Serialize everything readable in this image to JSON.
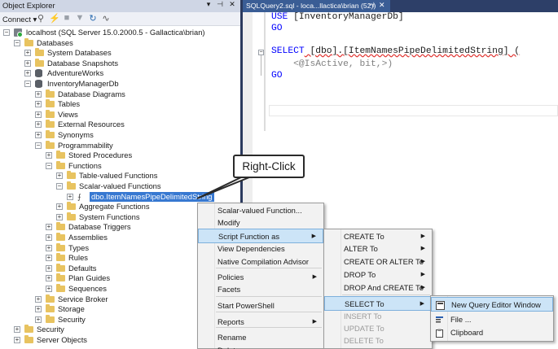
{
  "object_explorer": {
    "title": "Object Explorer",
    "title_controls": [
      "▾",
      "⊣",
      "✕"
    ],
    "toolbar": {
      "connect_label": "Connect ▾",
      "icons": [
        "plug-icon",
        "disconnect-icon",
        "stop-icon",
        "filter-icon",
        "refresh-icon",
        "activity-icon"
      ]
    },
    "tree": [
      {
        "label": "localhost (SQL Server 15.0.2000.5 - Gallactica\\brian)",
        "level": 0,
        "icon": "server",
        "expander": "−"
      },
      {
        "label": "Databases",
        "level": 1,
        "icon": "folder",
        "expander": "−"
      },
      {
        "label": "System Databases",
        "level": 2,
        "icon": "folder",
        "expander": "+"
      },
      {
        "label": "Database Snapshots",
        "level": 2,
        "icon": "folder",
        "expander": "+"
      },
      {
        "label": "AdventureWorks",
        "level": 2,
        "icon": "database",
        "expander": "+"
      },
      {
        "label": "InventoryManagerDb",
        "level": 2,
        "icon": "database",
        "expander": "−"
      },
      {
        "label": "Database Diagrams",
        "level": 3,
        "icon": "folder",
        "expander": "+"
      },
      {
        "label": "Tables",
        "level": 3,
        "icon": "folder",
        "expander": "+"
      },
      {
        "label": "Views",
        "level": 3,
        "icon": "folder",
        "expander": "+"
      },
      {
        "label": "External Resources",
        "level": 3,
        "icon": "folder",
        "expander": "+"
      },
      {
        "label": "Synonyms",
        "level": 3,
        "icon": "folder",
        "expander": "+"
      },
      {
        "label": "Programmability",
        "level": 3,
        "icon": "folder",
        "expander": "−"
      },
      {
        "label": "Stored Procedures",
        "level": 4,
        "icon": "folder",
        "expander": "+"
      },
      {
        "label": "Functions",
        "level": 4,
        "icon": "folder",
        "expander": "−"
      },
      {
        "label": "Table-valued Functions",
        "level": 5,
        "icon": "folder",
        "expander": "+"
      },
      {
        "label": "Scalar-valued Functions",
        "level": 5,
        "icon": "folder",
        "expander": "−"
      },
      {
        "label": "dbo.ItemNamesPipeDelimitedString",
        "level": 6,
        "icon": "function",
        "expander": "+",
        "selected": true
      },
      {
        "label": "Aggregate Functions",
        "level": 5,
        "icon": "folder",
        "expander": "+"
      },
      {
        "label": "System Functions",
        "level": 5,
        "icon": "folder",
        "expander": "+"
      },
      {
        "label": "Database Triggers",
        "level": 4,
        "icon": "folder",
        "expander": "+"
      },
      {
        "label": "Assemblies",
        "level": 4,
        "icon": "folder",
        "expander": "+"
      },
      {
        "label": "Types",
        "level": 4,
        "icon": "folder",
        "expander": "+"
      },
      {
        "label": "Rules",
        "level": 4,
        "icon": "folder",
        "expander": "+"
      },
      {
        "label": "Defaults",
        "level": 4,
        "icon": "folder",
        "expander": "+"
      },
      {
        "label": "Plan Guides",
        "level": 4,
        "icon": "folder",
        "expander": "+"
      },
      {
        "label": "Sequences",
        "level": 4,
        "icon": "folder",
        "expander": "+"
      },
      {
        "label": "Service Broker",
        "level": 3,
        "icon": "folder",
        "expander": "+"
      },
      {
        "label": "Storage",
        "level": 3,
        "icon": "folder",
        "expander": "+"
      },
      {
        "label": "Security",
        "level": 3,
        "icon": "folder",
        "expander": "+"
      },
      {
        "label": "Security",
        "level": 1,
        "icon": "folder",
        "expander": "+"
      },
      {
        "label": "Server Objects",
        "level": 1,
        "icon": "folder",
        "expander": "+"
      }
    ]
  },
  "editor": {
    "tab_label": "SQLQuery2.sql - loca...llactica\\brian (52))",
    "tab_pin": "⊣",
    "tab_close": "✕",
    "lines": [
      {
        "kw": "USE",
        "rest": " [InventoryManagerDb]"
      },
      {
        "kw": "GO",
        "rest": ""
      },
      {
        "kw": "",
        "rest": ""
      },
      {
        "kw": "SELECT",
        "rest": " [dbo].[ItemNamesPipeDelimitedString] ("
      },
      {
        "kw": "",
        "rest": "    <@IsActive, bit,>)"
      },
      {
        "kw": "GO",
        "rest": ""
      }
    ],
    "collapse_glyph": "−"
  },
  "callout": {
    "text": "Right-Click"
  },
  "context_menu": {
    "items": [
      {
        "label": "Scalar-valued Function...",
        "arrow": false
      },
      {
        "label": "Modify",
        "arrow": false
      },
      {
        "label": "Script Function as",
        "arrow": true,
        "highlighted": true
      },
      {
        "label": "View Dependencies",
        "arrow": false
      },
      {
        "label": "Native Compilation Advisor",
        "arrow": false
      },
      {
        "label": "Policies",
        "arrow": true
      },
      {
        "label": "Facets",
        "arrow": false
      },
      {
        "label": "Start PowerShell",
        "arrow": false
      },
      {
        "label": "Reports",
        "arrow": true
      },
      {
        "label": "Rename",
        "arrow": false
      },
      {
        "label": "Delete",
        "arrow": false
      }
    ]
  },
  "script_submenu": {
    "items": [
      {
        "label": "CREATE To",
        "arrow": true
      },
      {
        "label": "ALTER To",
        "arrow": true
      },
      {
        "label": "CREATE OR ALTER To",
        "arrow": true
      },
      {
        "label": "DROP To",
        "arrow": true
      },
      {
        "label": "DROP And CREATE To",
        "arrow": true
      },
      {
        "label": "SELECT To",
        "arrow": true,
        "highlighted": true
      },
      {
        "label": "INSERT To",
        "arrow": false,
        "disabled": true
      },
      {
        "label": "UPDATE To",
        "arrow": false,
        "disabled": true
      },
      {
        "label": "DELETE To",
        "arrow": false,
        "disabled": true
      }
    ]
  },
  "select_submenu": {
    "items": [
      {
        "label": "New Query Editor Window",
        "icon": "new-query-icon",
        "highlighted": true
      },
      {
        "label": "File ...",
        "icon": "file-icon"
      },
      {
        "label": "Clipboard",
        "icon": "clipboard-icon"
      }
    ]
  },
  "colors": {
    "selection": "#3778d1",
    "menu_highlight": "#cce4f7",
    "folder": "#e8c360",
    "keyword": "#0000ff",
    "tab_active": "#3a5d95",
    "tab_bar": "#2d3f68"
  }
}
